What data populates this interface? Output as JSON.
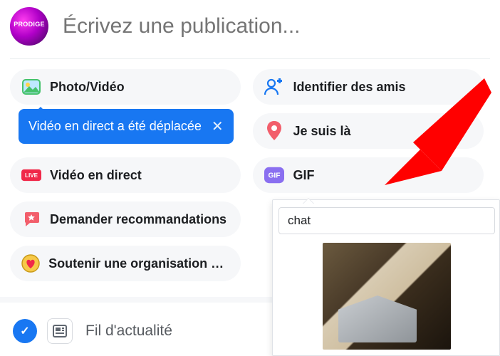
{
  "composer": {
    "placeholder": "Écrivez une publication..."
  },
  "chips": {
    "photo_video": "Photo/Vidéo",
    "tag_friends": "Identifier des amis",
    "location": "Je suis là",
    "live_video": "Vidéo en direct",
    "gif": "GIF",
    "ask_reco": "Demander recommandations",
    "support_org": "Soutenir une organisation à b…"
  },
  "tooltip": {
    "text": "Vidéo en direct a été déplacée",
    "close_glyph": "✕"
  },
  "feed": {
    "label": "Fil d'actualité",
    "check_glyph": "✓"
  },
  "gif_popover": {
    "search_value": "chat"
  },
  "colors": {
    "accent": "#1877f2",
    "live_red": "#f02849",
    "pin_red": "#f25e6b",
    "gif_purple": "#8a6ff0",
    "photo_green": "#45c26b",
    "heart_gold": "#f7c948",
    "arrow_red": "#ff0000"
  }
}
